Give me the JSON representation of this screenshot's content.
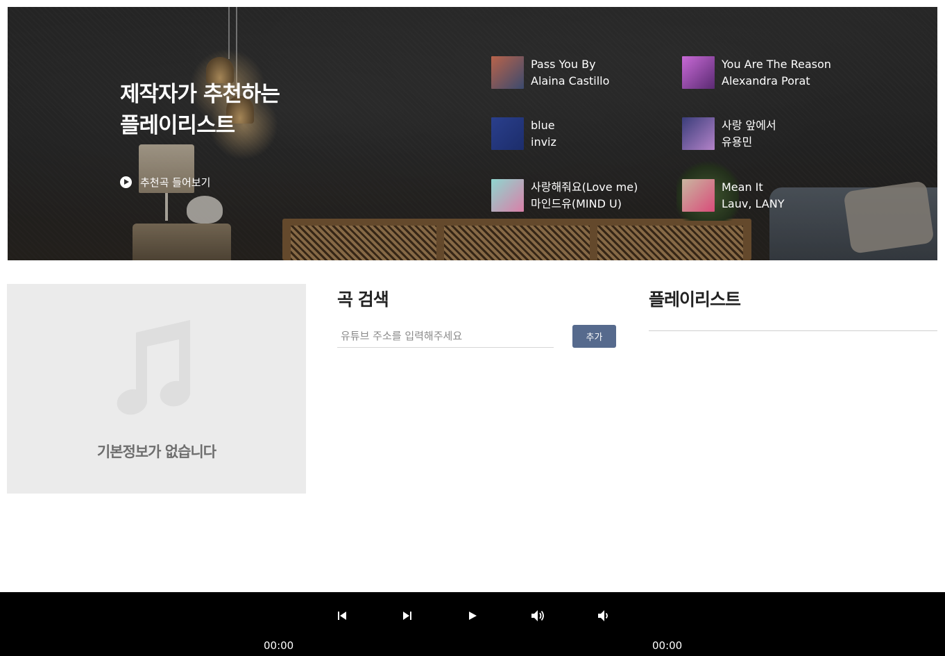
{
  "hero": {
    "title_line1": "제작자가 추천하는",
    "title_line2": "플레이리스트",
    "listen_label": "추천곡 들어보기",
    "recommendations": [
      {
        "title": "Pass You By",
        "artist": "Alaina Castillo",
        "colors": [
          "#b8634a",
          "#3b4a6e"
        ]
      },
      {
        "title": "You Are The Reason",
        "artist": "Alexandra Porat",
        "colors": [
          "#c86ad6",
          "#5a2a72"
        ]
      },
      {
        "title": "blue",
        "artist": "inviz",
        "colors": [
          "#2a3f8c",
          "#1c2d6b"
        ]
      },
      {
        "title": "사랑 앞에서",
        "artist": "유용민",
        "colors": [
          "#3a3d7a",
          "#b483c9"
        ]
      },
      {
        "title": "사랑해줘요(Love me)",
        "artist": "마인드유(MIND U)",
        "colors": [
          "#8fd6cf",
          "#d97fa8"
        ]
      },
      {
        "title": "Mean It",
        "artist": "Lauv, LANY",
        "colors": [
          "#c9b6a0",
          "#d94c7a"
        ]
      }
    ]
  },
  "info": {
    "empty_message": "기본정보가 없습니다"
  },
  "search": {
    "title": "곡 검색",
    "placeholder": "유튜브 주소를 입력해주세요",
    "add_label": "추가"
  },
  "playlist": {
    "title": "플레이리스트"
  },
  "player": {
    "current_time": "00:00",
    "total_time": "00:00"
  },
  "colors": {
    "accent": "#566a8d",
    "player_bg": "#000000",
    "info_bg": "#ebebeb"
  }
}
